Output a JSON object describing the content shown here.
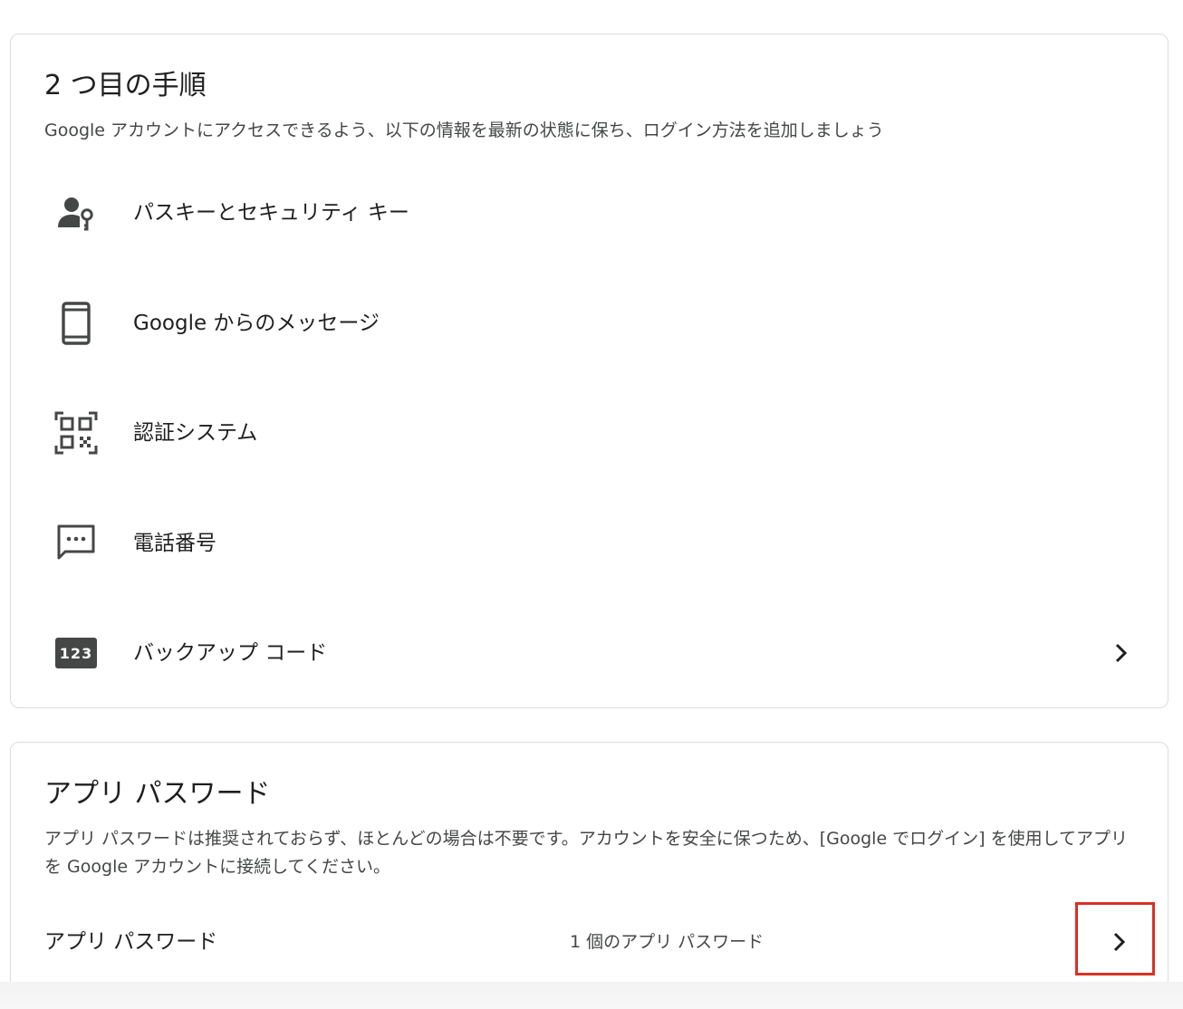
{
  "second_step": {
    "title": "2 つ目の手順",
    "description": "Google アカウントにアクセスできるよう、以下の情報を最新の状態に保ち、ログイン方法を追加しましょう",
    "methods": [
      {
        "label": "パスキーとセキュリティ キー",
        "icon": "passkey-icon"
      },
      {
        "label": "Google からのメッセージ",
        "icon": "phone-icon"
      },
      {
        "label": "認証システム",
        "icon": "qr-code-icon"
      },
      {
        "label": "電話番号",
        "icon": "sms-message-icon"
      },
      {
        "label": "バックアップ コード",
        "icon": "backup-code-icon",
        "icon_text": "123"
      }
    ]
  },
  "app_passwords": {
    "title": "アプリ パスワード",
    "description": "アプリ パスワードは推奨されておらず、ほとんどの場合は不要です。アカウントを安全に保つため、[Google でログイン] を使用してアプリを Google アカウントに接続してください。",
    "row_label": "アプリ パスワード",
    "row_value": "1 個のアプリ パスワード"
  },
  "colors": {
    "text_primary": "#1f1f1f",
    "text_secondary": "#444746",
    "icon": "#444746",
    "card_border": "#dadce0",
    "highlight": "#d93025"
  }
}
